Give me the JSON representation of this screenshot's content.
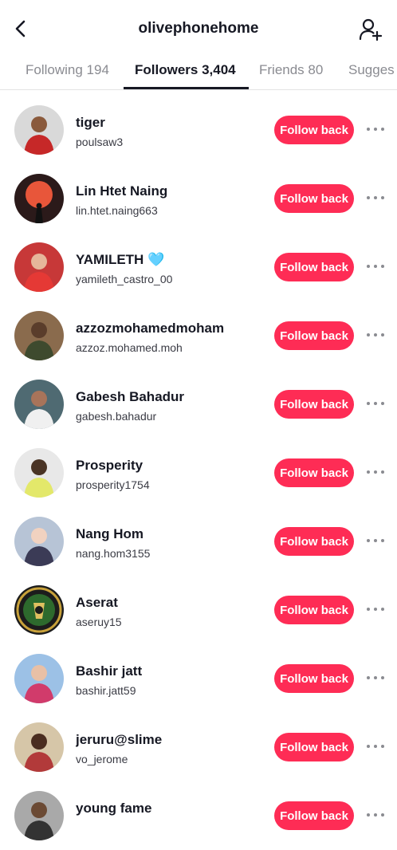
{
  "header": {
    "title": "olivephonehome"
  },
  "tabs": [
    {
      "label": "Following 194"
    },
    {
      "label": "Followers 3,404"
    },
    {
      "label": "Friends 80"
    },
    {
      "label": "Sugges"
    }
  ],
  "follow_label": "Follow back",
  "followers": [
    {
      "name": "tiger",
      "handle": "poulsaw3"
    },
    {
      "name": "Lin Htet Naing",
      "handle": "lin.htet.naing663"
    },
    {
      "name": "YAMILETH",
      "handle": "yamileth_castro_00",
      "badge": "🩵"
    },
    {
      "name": "azzozmohamedmoham",
      "handle": "azzoz.mohamed.moh"
    },
    {
      "name": "Gabesh Bahadur",
      "handle": "gabesh.bahadur"
    },
    {
      "name": "Prosperity",
      "handle": "prosperity1754"
    },
    {
      "name": "Nang Hom",
      "handle": "nang.hom3155"
    },
    {
      "name": "Aserat",
      "handle": "aseruy15"
    },
    {
      "name": "Bashir jatt",
      "handle": "bashir.jatt59"
    },
    {
      "name": "jeruru@slime",
      "handle": "vo_jerome"
    },
    {
      "name": "young fame",
      "handle": ""
    }
  ],
  "colors": {
    "accent": "#fe2c55",
    "text": "#161823",
    "muted": "#8a8b91"
  }
}
